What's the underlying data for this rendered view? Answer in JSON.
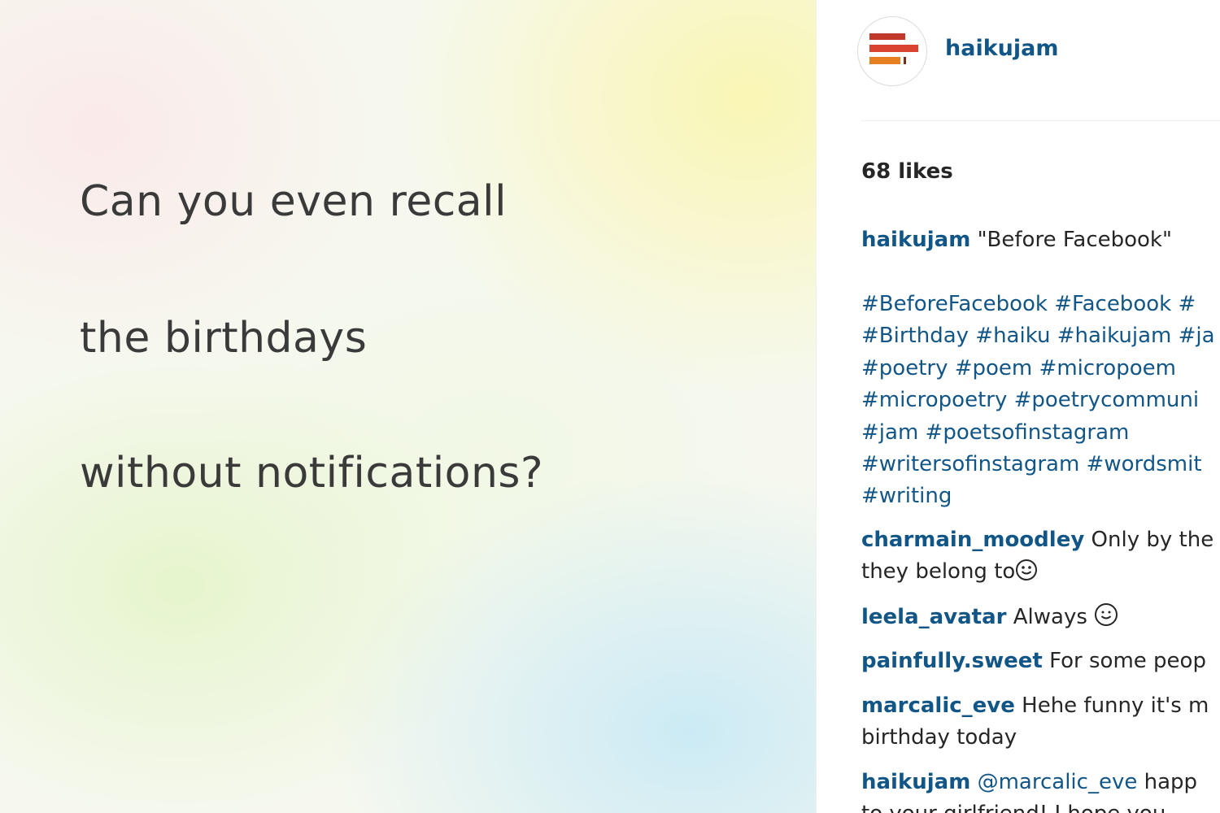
{
  "post": {
    "lines": [
      "Can you even recall",
      "the birthdays",
      "without notifications?"
    ]
  },
  "sidebar": {
    "username": "haikujam",
    "likes": "68 likes",
    "caption": {
      "user": "haikujam",
      "text": "\"Before Facebook\""
    },
    "hashtag_rows": [
      [
        "#BeforeFacebook",
        "#Facebook",
        "#"
      ],
      [
        "#Birthday",
        "#haiku",
        "#haikujam",
        "#ja"
      ],
      [
        "#poetry",
        "#poem",
        "#micropoem"
      ],
      [
        "#micropoetry",
        "#poetrycommuni"
      ],
      [
        "#jam",
        "#poetsofinstagram"
      ],
      [
        "#writersofinstagram",
        "#wordsmit"
      ],
      [
        "#writing"
      ]
    ],
    "comments": [
      {
        "user": "charmain_moodley",
        "text": "Only by the",
        "text2": "they belong to"
      },
      {
        "user": "leela_avatar",
        "text": "Always"
      },
      {
        "user": "painfully.sweet",
        "text": "For some peop"
      },
      {
        "user": "marcalic_eve",
        "text": "Hehe funny it's m",
        "text2": "birthday today"
      },
      {
        "user": "haikujam",
        "mention": "@marcalic_eve",
        "text": "happ",
        "text2": "to your girlfriend! I hope you"
      }
    ]
  },
  "colors": {
    "link": "#125688",
    "text": "#262626",
    "logo_red": "#c0392b",
    "logo_orange": "#e67e22"
  },
  "icons": {
    "avatar": "haikujam-logo-icon",
    "emoji": "smiley-face-icon"
  }
}
